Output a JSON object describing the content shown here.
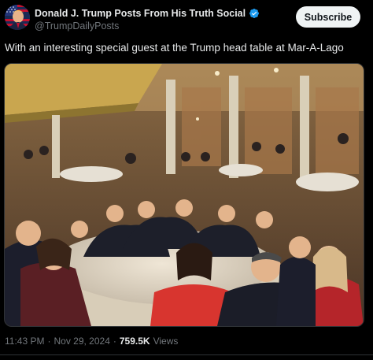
{
  "post": {
    "author": {
      "display_name": "Donald J. Trump Posts From His Truth Social",
      "handle": "@TrumpDailyPosts",
      "verified": true,
      "verified_color": "#1d9bf0",
      "avatar_icon": "us-flag-portrait-avatar"
    },
    "subscribe_label": "Subscribe",
    "text": "With an interesting special guest at the Trump head table at Mar-A-Lago",
    "media": {
      "type": "photo"
    },
    "meta": {
      "time": "11:43 PM",
      "separator": "·",
      "date": "Nov 29, 2024",
      "views_count": "759.5K",
      "views_label": "Views"
    }
  },
  "theme": {
    "background": "#000000",
    "text": "#e7e9ea",
    "secondary_text": "#71767b",
    "button_bg": "#eff3f4",
    "button_text": "#0f1419"
  }
}
